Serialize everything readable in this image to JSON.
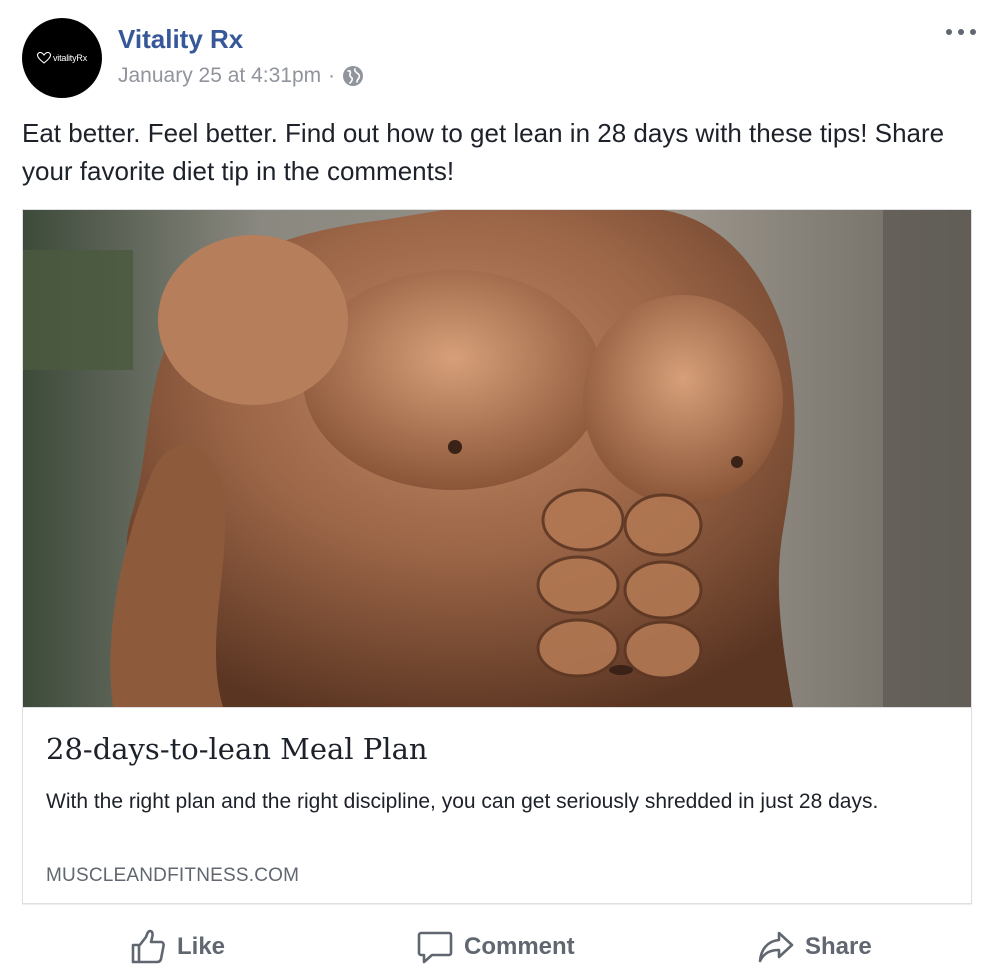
{
  "post": {
    "page_name": "Vitality Rx",
    "avatar_text": "vitalityRx",
    "timestamp": "January 25 at 4:31pm",
    "separator": "·",
    "privacy_icon": "globe-icon",
    "text": "Eat better. Feel better. Find out how to get lean in 28 days with these tips! Share your favorite diet tip in the comments!"
  },
  "link_preview": {
    "title": "28-days-to-lean Meal Plan",
    "description": "With the right plan and the right discipline, you can get seriously shredded in just 28 days.",
    "domain": "MUSCLEANDFITNESS.COM"
  },
  "actions": {
    "like": "Like",
    "comment": "Comment",
    "share": "Share"
  },
  "colors": {
    "page_name": "#365899",
    "meta": "#90949c",
    "action": "#606770",
    "border": "#dddfe2"
  }
}
